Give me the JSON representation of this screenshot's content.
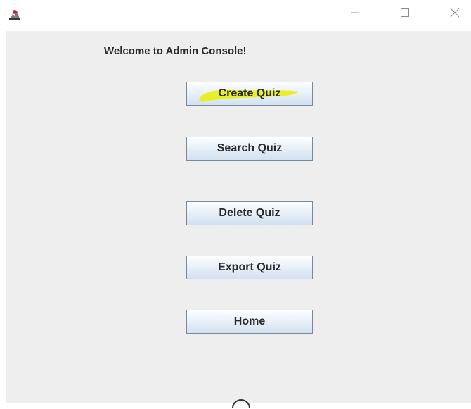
{
  "window": {
    "icons": {
      "app": "java-duke-icon",
      "minimize": "minimize-icon",
      "maximize": "maximize-icon",
      "close": "close-icon"
    }
  },
  "console": {
    "welcome": "Welcome to Admin Console!",
    "buttons": {
      "create": "Create Quiz",
      "search": "Search Quiz",
      "delete": "Delete Quiz",
      "export": "Export Quiz",
      "home": "Home"
    },
    "highlight_color": "#e8f000"
  },
  "colors": {
    "panel_bg": "#eeeeee",
    "button_border": "#7a8a9e",
    "text": "#2a2a2a"
  }
}
